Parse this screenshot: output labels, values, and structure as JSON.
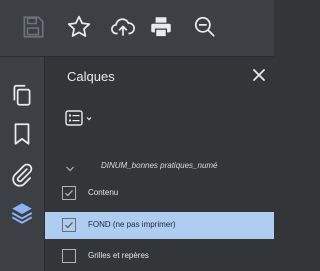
{
  "toolbar": {
    "icons": [
      "save-icon",
      "bookmark-star-icon",
      "upload-cloud-icon",
      "print-icon",
      "zoom-out-icon"
    ]
  },
  "sidebar": {
    "icons": [
      "pages-copy-icon",
      "bookmark-icon",
      "attachment-icon",
      "layers-icon"
    ],
    "active_icon": "layers-icon"
  },
  "layers_panel": {
    "title": "Calques",
    "close_icon": "close-icon",
    "options_icon": "list-options-icon",
    "document_name": "DINUM_bonnes pratiques_numé",
    "layers": [
      {
        "label": "Contenu",
        "checked": true,
        "selected": false
      },
      {
        "label": "FOND (ne pas imprimer)",
        "checked": true,
        "selected": true
      },
      {
        "label": "Grilles et repères",
        "checked": false,
        "selected": false
      }
    ]
  },
  "colors": {
    "panel_bg": "#323639",
    "toolbar_bg": "#3c3f43",
    "selection": "#aecdf1",
    "active_icon": "#8ab4f8"
  }
}
